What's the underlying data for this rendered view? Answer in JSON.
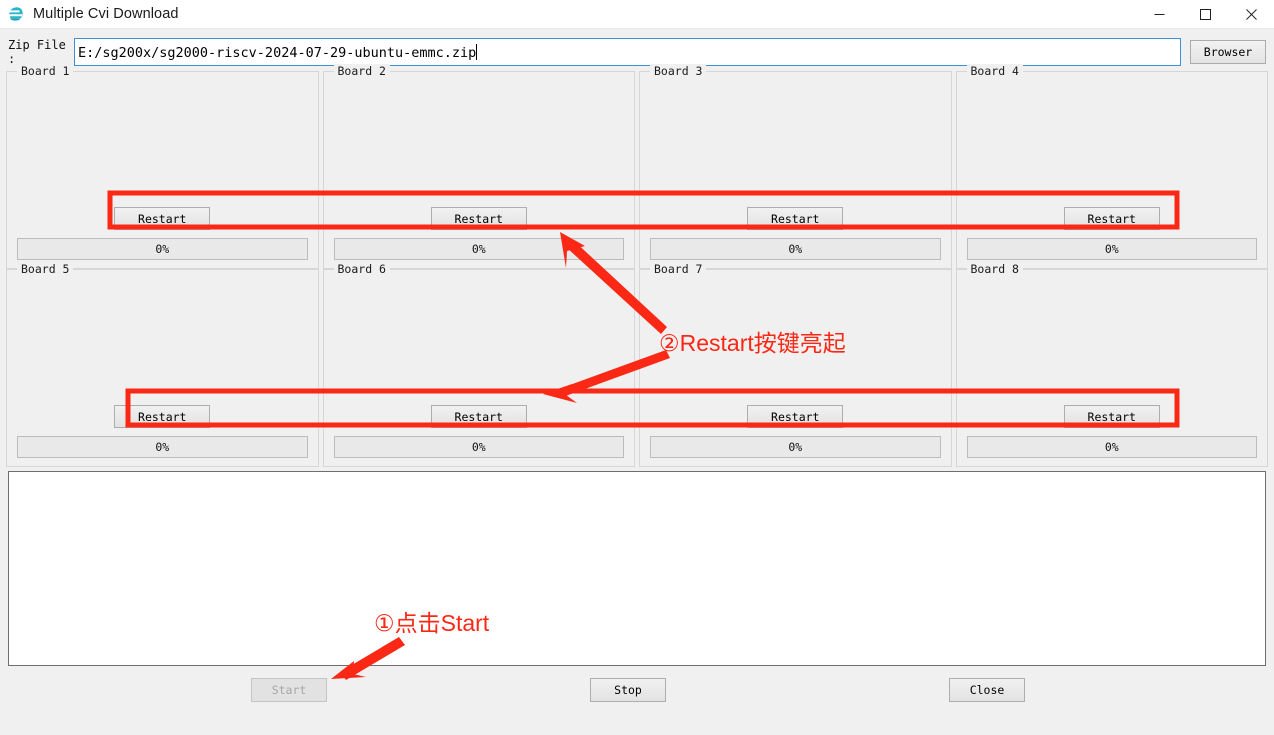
{
  "window": {
    "title": "Multiple Cvi Download",
    "icon": "app-logo-icon",
    "minimize_label": "─",
    "maximize_label": "□",
    "close_label": "✕"
  },
  "zip": {
    "label": "Zip File :",
    "value": "E:/sg200x/sg2000-riscv-2024-07-29-ubuntu-emmc.zip",
    "placeholder": "",
    "browse_label": "Browser"
  },
  "boards": [
    {
      "title": "Board 1",
      "restart_label": "Restart",
      "progress_label": "0%",
      "progress_value": 0
    },
    {
      "title": "Board 2",
      "restart_label": "Restart",
      "progress_label": "0%",
      "progress_value": 0
    },
    {
      "title": "Board 3",
      "restart_label": "Restart",
      "progress_label": "0%",
      "progress_value": 0
    },
    {
      "title": "Board 4",
      "restart_label": "Restart",
      "progress_label": "0%",
      "progress_value": 0
    },
    {
      "title": "Board 5",
      "restart_label": "Restart",
      "progress_label": "0%",
      "progress_value": 0
    },
    {
      "title": "Board 6",
      "restart_label": "Restart",
      "progress_label": "0%",
      "progress_value": 0
    },
    {
      "title": "Board 7",
      "restart_label": "Restart",
      "progress_label": "0%",
      "progress_value": 0
    },
    {
      "title": "Board 8",
      "restart_label": "Restart",
      "progress_label": "0%",
      "progress_value": 0
    }
  ],
  "log": {
    "text": ""
  },
  "footer": {
    "start_label": "Start",
    "stop_label": "Stop",
    "close_label": "Close"
  },
  "annotations": {
    "color": "#fa2814",
    "step1_text": "①点击Start",
    "step2_text": "②Restart按键亮起"
  }
}
